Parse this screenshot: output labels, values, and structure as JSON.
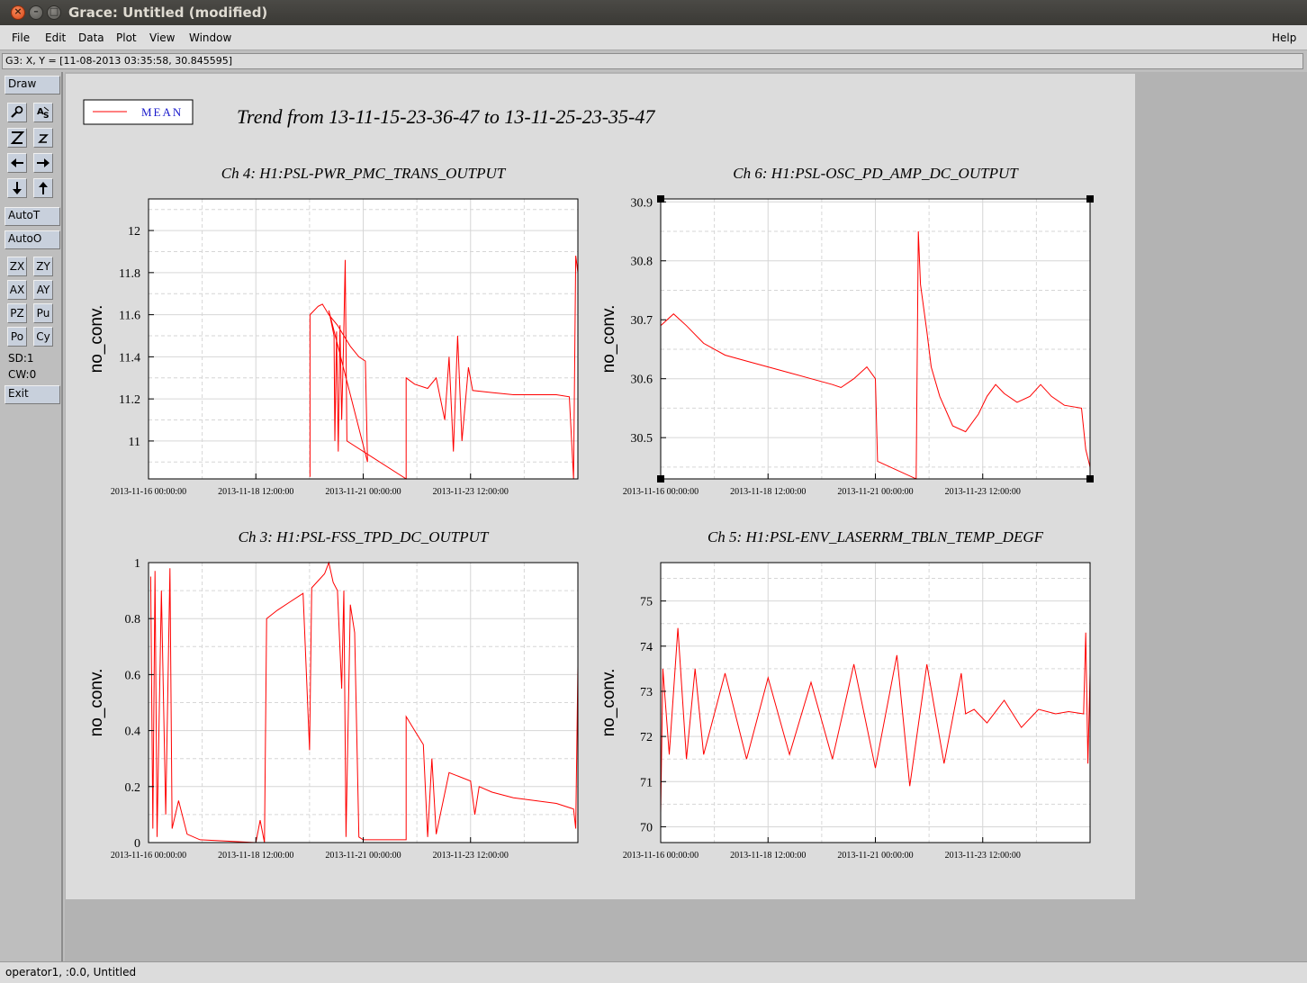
{
  "window": {
    "title": "Grace: Untitled (modified)",
    "close_glyph": "×",
    "min_glyph": "–",
    "max_glyph": "□"
  },
  "menu": {
    "file": "File",
    "edit": "Edit",
    "data": "Data",
    "plot": "Plot",
    "view": "View",
    "window": "Window",
    "help": "Help"
  },
  "locator": "G3: X, Y = [11-08-2013 03:35:58, 30.845595]",
  "toolbar": {
    "draw": "Draw",
    "autot": "AutoT",
    "autoo": "AutoO",
    "zx": "ZX",
    "zy": "ZY",
    "ax": "AX",
    "ay": "AY",
    "pz": "PZ",
    "pu": "Pu",
    "po": "Po",
    "cy": "Cy",
    "sd": "SD:1",
    "cw": "CW:0",
    "exit": "Exit",
    "icons": [
      "magnifier-icon",
      "text-tool-icon",
      "zoom-icon",
      "zoom-small-icon",
      "arrow-left-icon",
      "arrow-right-icon",
      "arrow-down-icon",
      "arrow-up-icon"
    ]
  },
  "page_title": "Trend from 13-11-15-23-36-47 to 13-11-25-23-35-47",
  "legend": {
    "label": "MEAN",
    "color": "#ff0000"
  },
  "status": "operator1, :0.0, Untitled",
  "colors": {
    "trace": "#ff0000",
    "page": "#dcdcdc",
    "grid": "#d6d6d6"
  },
  "chart_data": [
    {
      "type": "line",
      "title": "Ch 4: H1:PSL-PWR_PMC_TRANS_OUTPUT",
      "ylabel": "no_conv.",
      "xlabel": "",
      "x_ticks": [
        "2013-11-16 00:00:00",
        "2013-11-18 12:00:00",
        "2013-11-21 00:00:00",
        "2013-11-23 12:00:00"
      ],
      "y_ticks": [
        "11",
        "11.2",
        "11.4",
        "11.6",
        "11.8",
        "12"
      ],
      "ylim": [
        10.82,
        12.15
      ],
      "xlim_days": [
        0,
        10
      ],
      "grid": true,
      "series": [
        {
          "name": "MEAN",
          "values": [
            [
              3.76,
              10.83
            ],
            [
              3.76,
              11.6
            ],
            [
              3.95,
              11.64
            ],
            [
              4.05,
              11.65
            ],
            [
              4.2,
              11.6
            ],
            [
              4.4,
              11.55
            ],
            [
              4.55,
              11.5
            ],
            [
              4.7,
              11.45
            ],
            [
              4.9,
              11.4
            ],
            [
              5.05,
              11.38
            ],
            [
              5.1,
              10.9
            ],
            [
              4.2,
              11.62
            ],
            [
              4.32,
              11.5
            ],
            [
              4.34,
              11.0
            ],
            [
              4.38,
              11.52
            ],
            [
              4.42,
              10.95
            ],
            [
              4.46,
              11.55
            ],
            [
              4.5,
              11.1
            ],
            [
              4.54,
              11.45
            ],
            [
              4.58,
              11.86
            ],
            [
              4.62,
              11.0
            ],
            [
              6.0,
              10.82
            ],
            [
              6.0,
              11.3
            ],
            [
              6.2,
              11.27
            ],
            [
              6.5,
              11.25
            ],
            [
              6.7,
              11.3
            ],
            [
              6.9,
              11.1
            ],
            [
              7.0,
              11.4
            ],
            [
              7.1,
              10.95
            ],
            [
              7.2,
              11.5
            ],
            [
              7.3,
              11.0
            ],
            [
              7.45,
              11.35
            ],
            [
              7.55,
              11.24
            ],
            [
              8.0,
              11.23
            ],
            [
              8.5,
              11.22
            ],
            [
              9.0,
              11.22
            ],
            [
              9.5,
              11.22
            ],
            [
              9.8,
              11.21
            ],
            [
              9.9,
              10.82
            ],
            [
              9.95,
              11.88
            ],
            [
              10.0,
              11.8
            ]
          ]
        }
      ]
    },
    {
      "type": "line",
      "title": "Ch 6: H1:PSL-OSC_PD_AMP_DC_OUTPUT",
      "ylabel": "no_conv.",
      "xlabel": "",
      "x_ticks": [
        "2013-11-16 00:00:00",
        "2013-11-18 12:00:00",
        "2013-11-21 00:00:00",
        "2013-11-23 12:00:00"
      ],
      "y_ticks": [
        "30.5",
        "30.6",
        "30.7",
        "30.8",
        "30.9"
      ],
      "ylim": [
        30.43,
        30.905
      ],
      "xlim_days": [
        0,
        10
      ],
      "grid": true,
      "series": [
        {
          "name": "MEAN",
          "values": [
            [
              0,
              30.69
            ],
            [
              0.3,
              30.71
            ],
            [
              0.6,
              30.69
            ],
            [
              1.0,
              30.66
            ],
            [
              1.5,
              30.64
            ],
            [
              2.0,
              30.63
            ],
            [
              2.5,
              30.62
            ],
            [
              3.0,
              30.61
            ],
            [
              3.5,
              30.6
            ],
            [
              4.0,
              30.59
            ],
            [
              4.2,
              30.585
            ],
            [
              4.5,
              30.6
            ],
            [
              4.8,
              30.62
            ],
            [
              5.0,
              30.6
            ],
            [
              5.05,
              30.46
            ],
            [
              5.95,
              30.43
            ],
            [
              6.0,
              30.85
            ],
            [
              6.05,
              30.76
            ],
            [
              6.2,
              30.68
            ],
            [
              6.3,
              30.62
            ],
            [
              6.5,
              30.57
            ],
            [
              6.8,
              30.52
            ],
            [
              7.1,
              30.51
            ],
            [
              7.4,
              30.54
            ],
            [
              7.6,
              30.57
            ],
            [
              7.8,
              30.59
            ],
            [
              8.0,
              30.575
            ],
            [
              8.3,
              30.56
            ],
            [
              8.6,
              30.57
            ],
            [
              8.85,
              30.59
            ],
            [
              9.1,
              30.57
            ],
            [
              9.4,
              30.555
            ],
            [
              9.8,
              30.55
            ],
            [
              9.9,
              30.48
            ],
            [
              10.0,
              30.45
            ]
          ]
        }
      ]
    },
    {
      "type": "line",
      "title": "Ch 3: H1:PSL-FSS_TPD_DC_OUTPUT",
      "ylabel": "no_conv.",
      "xlabel": "",
      "x_ticks": [
        "2013-11-16 00:00:00",
        "2013-11-18 12:00:00",
        "2013-11-21 00:00:00",
        "2013-11-23 12:00:00"
      ],
      "y_ticks": [
        "0",
        "0.2",
        "0.4",
        "0.6",
        "0.8",
        "1"
      ],
      "ylim": [
        0,
        1
      ],
      "xlim_days": [
        0,
        10
      ],
      "grid": true,
      "series": [
        {
          "name": "MEAN",
          "values": [
            [
              0.05,
              0.95
            ],
            [
              0.1,
              0.05
            ],
            [
              0.15,
              0.97
            ],
            [
              0.2,
              0.02
            ],
            [
              0.3,
              0.9
            ],
            [
              0.4,
              0.1
            ],
            [
              0.5,
              0.98
            ],
            [
              0.55,
              0.05
            ],
            [
              0.7,
              0.15
            ],
            [
              0.9,
              0.03
            ],
            [
              1.2,
              0.01
            ],
            [
              2.5,
              0.0
            ],
            [
              2.6,
              0.08
            ],
            [
              2.7,
              0.0
            ],
            [
              2.75,
              0.8
            ],
            [
              3.0,
              0.83
            ],
            [
              3.3,
              0.86
            ],
            [
              3.6,
              0.89
            ],
            [
              3.75,
              0.33
            ],
            [
              3.8,
              0.91
            ],
            [
              4.1,
              0.96
            ],
            [
              4.2,
              1.0
            ],
            [
              4.3,
              0.93
            ],
            [
              4.4,
              0.9
            ],
            [
              4.5,
              0.55
            ],
            [
              4.55,
              0.9
            ],
            [
              4.6,
              0.02
            ],
            [
              4.7,
              0.85
            ],
            [
              4.8,
              0.75
            ],
            [
              4.9,
              0.02
            ],
            [
              5.0,
              0.01
            ],
            [
              6.0,
              0.01
            ],
            [
              6.0,
              0.45
            ],
            [
              6.2,
              0.4
            ],
            [
              6.4,
              0.35
            ],
            [
              6.5,
              0.02
            ],
            [
              6.6,
              0.3
            ],
            [
              6.7,
              0.03
            ],
            [
              7.0,
              0.25
            ],
            [
              7.5,
              0.22
            ],
            [
              7.6,
              0.1
            ],
            [
              7.7,
              0.2
            ],
            [
              8.0,
              0.18
            ],
            [
              8.5,
              0.16
            ],
            [
              9.0,
              0.15
            ],
            [
              9.5,
              0.14
            ],
            [
              9.9,
              0.12
            ],
            [
              9.95,
              0.05
            ],
            [
              10.0,
              0.63
            ]
          ]
        }
      ]
    },
    {
      "type": "line",
      "title": "Ch 5: H1:PSL-ENV_LASERRM_TBLN_TEMP_DEGF",
      "ylabel": "no_conv.",
      "xlabel": "",
      "x_ticks": [
        "2013-11-16 00:00:00",
        "2013-11-18 12:00:00",
        "2013-11-21 00:00:00",
        "2013-11-23 12:00:00"
      ],
      "y_ticks": [
        "70",
        "71",
        "72",
        "73",
        "74",
        "75"
      ],
      "ylim": [
        69.65,
        75.85
      ],
      "xlim_days": [
        0,
        10
      ],
      "grid": true,
      "series": [
        {
          "name": "MEAN",
          "values": [
            [
              0.0,
              70.3
            ],
            [
              0.05,
              73.5
            ],
            [
              0.2,
              71.6
            ],
            [
              0.4,
              74.4
            ],
            [
              0.6,
              71.5
            ],
            [
              0.8,
              73.5
            ],
            [
              1.0,
              71.6
            ],
            [
              1.5,
              73.4
            ],
            [
              2.0,
              71.5
            ],
            [
              2.5,
              73.3
            ],
            [
              3.0,
              71.6
            ],
            [
              3.5,
              73.2
            ],
            [
              4.0,
              71.5
            ],
            [
              4.5,
              73.6
            ],
            [
              5.0,
              71.3
            ],
            [
              5.5,
              73.8
            ],
            [
              5.8,
              70.9
            ],
            [
              6.2,
              73.6
            ],
            [
              6.6,
              71.4
            ],
            [
              7.0,
              73.4
            ],
            [
              7.1,
              72.5
            ],
            [
              7.3,
              72.6
            ],
            [
              7.6,
              72.3
            ],
            [
              8.0,
              72.8
            ],
            [
              8.4,
              72.2
            ],
            [
              8.8,
              72.6
            ],
            [
              9.2,
              72.5
            ],
            [
              9.5,
              72.55
            ],
            [
              9.85,
              72.5
            ],
            [
              9.9,
              74.3
            ],
            [
              9.95,
              71.4
            ],
            [
              10.0,
              73.4
            ]
          ]
        }
      ]
    }
  ]
}
